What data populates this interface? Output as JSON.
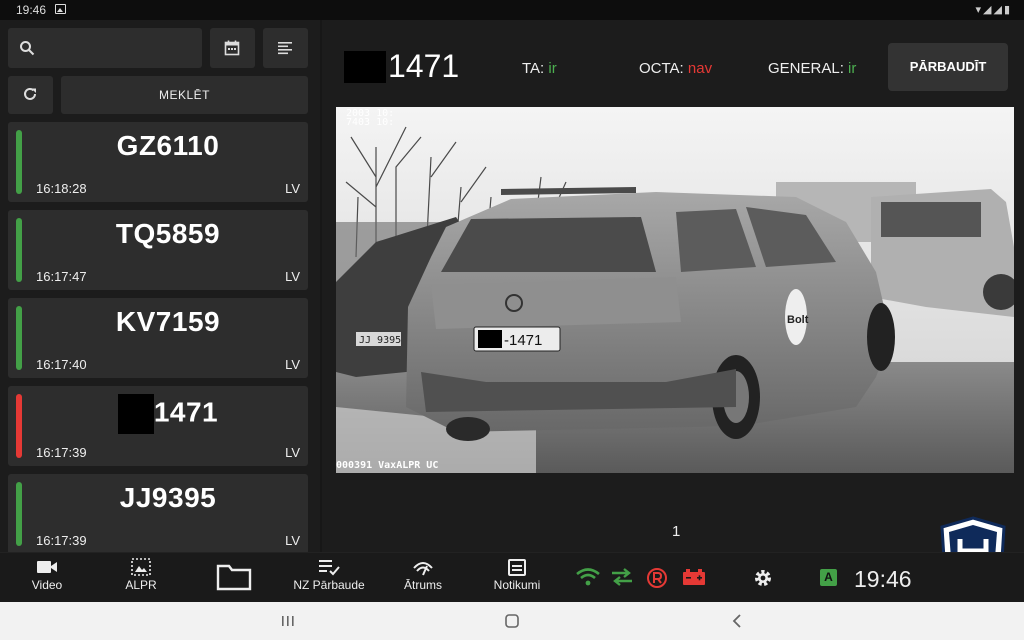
{
  "statusbar": {
    "time": "19:46",
    "icons": "▾◢◢▮"
  },
  "left": {
    "search_placeholder": "",
    "meklet_label": "MEKLĒT",
    "records": [
      {
        "plate": "GZ6110",
        "time": "16:18:28",
        "country": "LV",
        "status": "ok",
        "color": "#43a047"
      },
      {
        "plate": "TQ5859",
        "time": "16:17:47",
        "country": "LV",
        "status": "ok",
        "color": "#43a047"
      },
      {
        "plate": "KV7159",
        "time": "16:17:40",
        "country": "LV",
        "status": "ok",
        "color": "#43a047"
      },
      {
        "plate": "1471",
        "time": "16:17:39",
        "country": "LV",
        "status": "fail",
        "color": "#e53935"
      },
      {
        "plate": "JJ9395",
        "time": "16:17:39",
        "country": "LV",
        "status": "ok",
        "color": "#43a047"
      }
    ]
  },
  "detail": {
    "plate": "1471",
    "ta_label": "TA:",
    "ta_value": "ir",
    "octa_label": "OCTA:",
    "octa_value": "nav",
    "general_label": "GENERAL:",
    "general_value": "ir",
    "check_button": "PĀRBAUDĪT",
    "camera_overlay_top_1": "2003 10:",
    "camera_overlay_top_2": "7403 10:",
    "camera_overlay_bottom": "000391 VaxALPR UC",
    "camera_plate": "-1471",
    "camera_car_plate_2": "JJ 9395",
    "camera_brand": "Bolt",
    "page_number": "1"
  },
  "nav": {
    "video": "Video",
    "alpr": "ALPR",
    "nz": "NZ Pārbaude",
    "atrums": "Ātrums",
    "notikumi": "Notikumi",
    "gps_badge": "A",
    "clock": "19:46"
  },
  "colors": {
    "ok": "#4caf50",
    "bad": "#e53935",
    "panel": "#2d2d2d",
    "bg": "#1c1c1c"
  }
}
